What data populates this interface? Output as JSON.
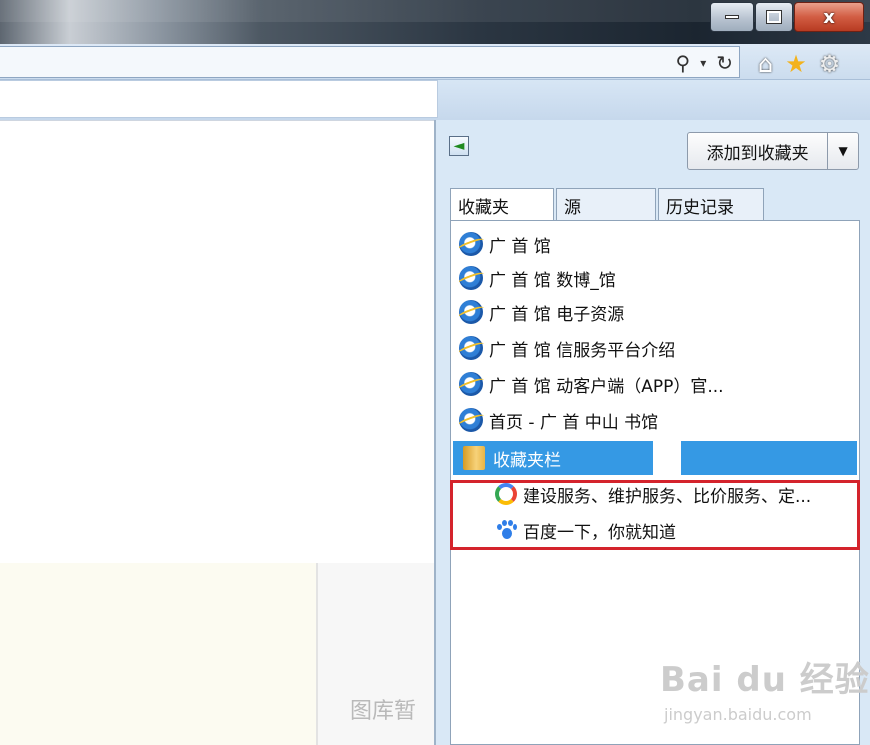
{
  "window": {
    "minimize_icon": "minimize-icon",
    "maximize_icon": "restore-icon",
    "close_glyph": "x"
  },
  "toolbar": {
    "search_icon": "search-icon",
    "dropdown_icon": "chevron-down-icon",
    "refresh_icon": "refresh-icon",
    "home_icon": "home-icon",
    "favorites_icon": "star-icon",
    "settings_icon": "gear-icon"
  },
  "page": {
    "placeholder_text": "图库暂"
  },
  "favorites_panel": {
    "add_button_label": "添加到收藏夹",
    "tabs": [
      {
        "label": "收藏夹",
        "active": true
      },
      {
        "label": "源",
        "active": false
      },
      {
        "label": "历史记录",
        "active": false
      }
    ],
    "items": [
      {
        "label": "广  首  馆",
        "icon": "ie-icon"
      },
      {
        "label": "广  首  馆 数博_馆",
        "icon": "ie-icon"
      },
      {
        "label": "广  首  馆 电子资源",
        "icon": "ie-icon"
      },
      {
        "label": "广  首  馆 信服务平台介绍",
        "icon": "ie-icon"
      },
      {
        "label": "广  首  馆 动客户端（APP）官...",
        "icon": "ie-icon"
      },
      {
        "label": "首页 - 广 首 中山 书馆",
        "icon": "ie-icon"
      }
    ],
    "folder": {
      "label": "收藏夹栏",
      "icon": "folder-icon",
      "children": [
        {
          "label": "建设服务、维护服务、比价服务、定...",
          "icon": "google-icon"
        },
        {
          "label": "百度一下，你就知道",
          "icon": "baidu-paw-icon"
        }
      ]
    }
  },
  "watermark": {
    "brand": "Bai du 经验",
    "url": "jingyan.baidu.com"
  }
}
